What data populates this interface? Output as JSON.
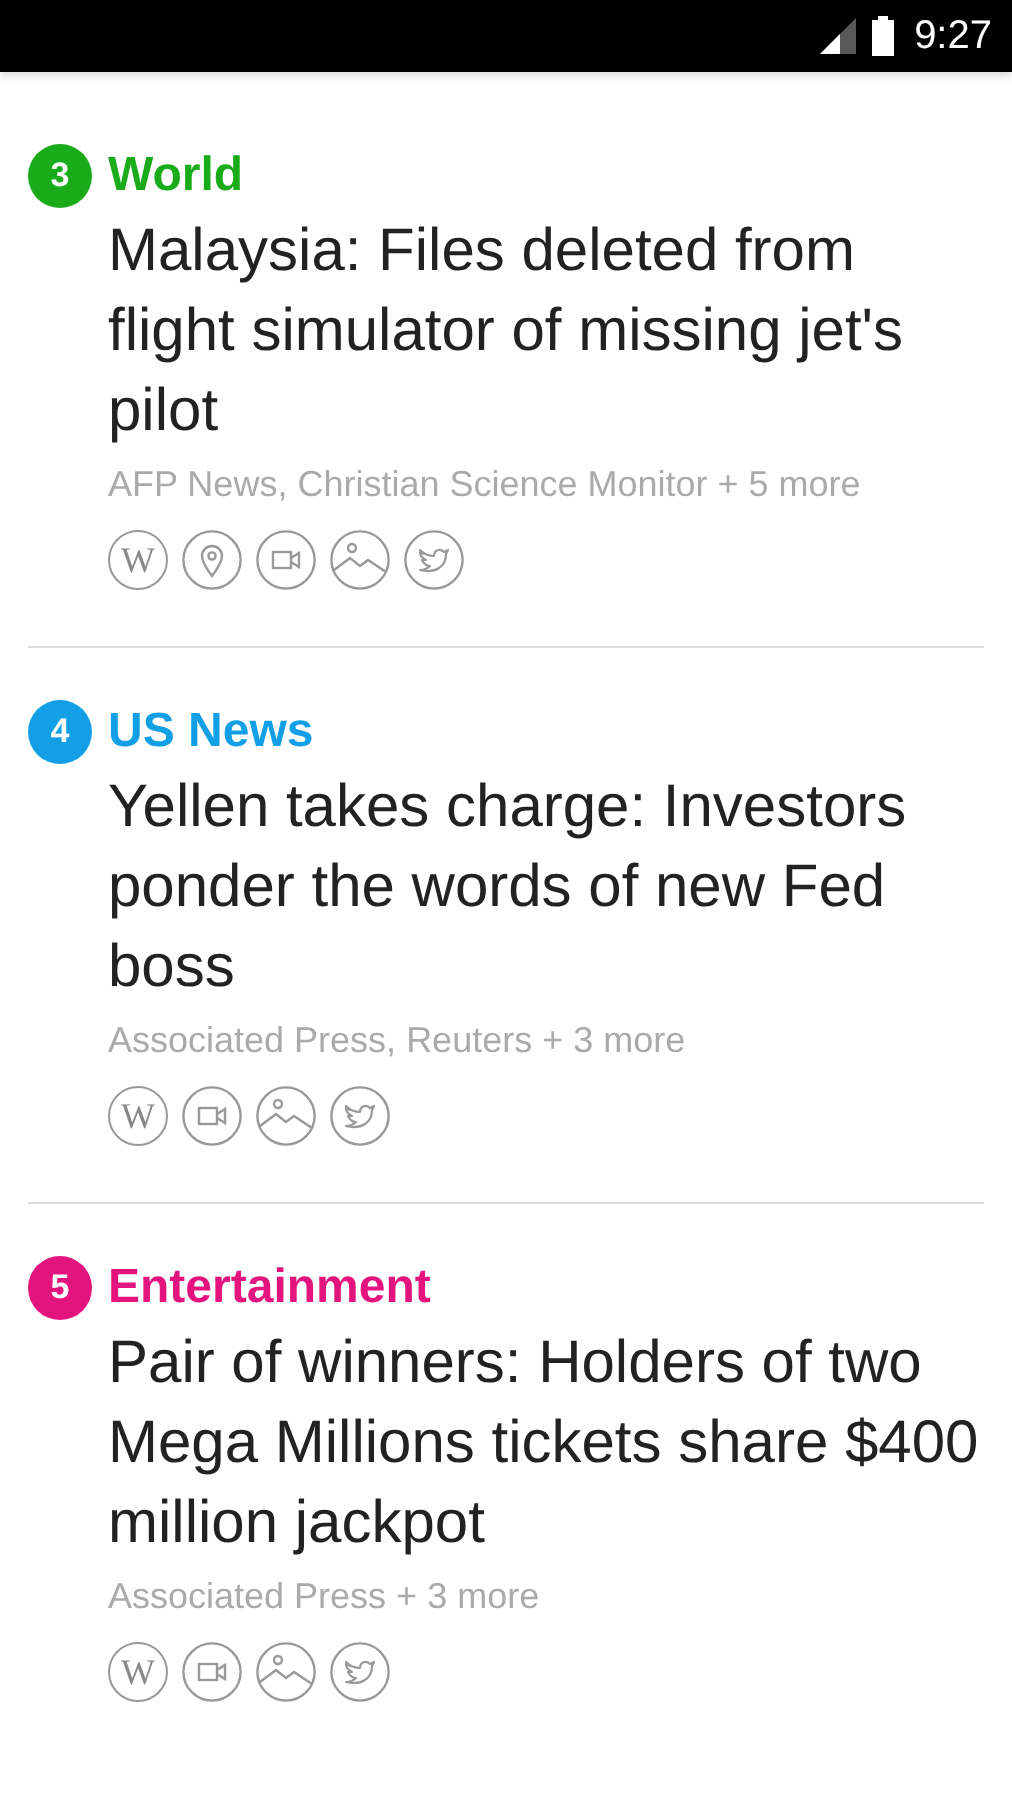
{
  "status_bar": {
    "time": "9:27"
  },
  "stories": [
    {
      "rank": "3",
      "category": "World",
      "color": "#1aab1a",
      "headline": "Malaysia: Files deleted from flight simulator of missing jet's pilot",
      "sources": "AFP News, Christian Science Monitor + 5 more",
      "links": [
        {
          "kind": "wikipedia",
          "label": "W"
        },
        {
          "kind": "location"
        },
        {
          "kind": "video"
        },
        {
          "kind": "photo"
        },
        {
          "kind": "twitter"
        }
      ]
    },
    {
      "rank": "4",
      "category": "US News",
      "color": "#139fe6",
      "headline": "Yellen takes charge: Investors ponder the words of new Fed boss",
      "sources": "Associated Press, Reuters + 3 more",
      "links": [
        {
          "kind": "wikipedia",
          "label": "W"
        },
        {
          "kind": "video"
        },
        {
          "kind": "photo"
        },
        {
          "kind": "twitter"
        }
      ]
    },
    {
      "rank": "5",
      "category": "Entertainment",
      "color": "#e4147e",
      "headline": "Pair of winners: Holders of two Mega Millions tickets share $400 million jackpot",
      "sources": "Associated Press + 3 more",
      "links": [
        {
          "kind": "wikipedia",
          "label": "W"
        },
        {
          "kind": "video"
        },
        {
          "kind": "photo"
        },
        {
          "kind": "twitter"
        }
      ]
    }
  ]
}
